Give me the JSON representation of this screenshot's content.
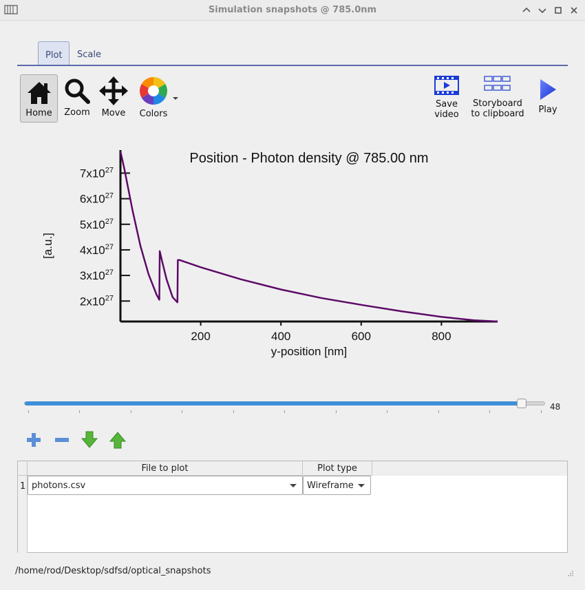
{
  "window": {
    "title": "Simulation snapshots @ 785.0nm"
  },
  "tabs": [
    {
      "label": "Plot",
      "active": true
    },
    {
      "label": "Scale",
      "active": false
    }
  ],
  "toolbar": {
    "home_label": "Home",
    "zoom_label": "Zoom",
    "move_label": "Move",
    "colors_label": "Colors",
    "save_video_label": [
      "Save",
      "video"
    ],
    "storyboard_label": [
      "Storyboard",
      "to clipboard"
    ],
    "play_label": "Play"
  },
  "chart_data": {
    "type": "line",
    "title": "Position - Photon density @ 785.00 nm",
    "xlabel": "y-position [nm]",
    "ylabel": "[a.u.]",
    "xlim": [
      0,
      940
    ],
    "ylim": [
      1.2e+27,
      7.9e+27
    ],
    "xticks": [
      200,
      400,
      600,
      800
    ],
    "yticks": [
      2e+27,
      3e+27,
      4e+27,
      5e+27,
      6e+27,
      7e+27
    ],
    "ytick_mantissas": [
      "2",
      "3",
      "4",
      "5",
      "6",
      "7"
    ],
    "ytick_base": "x10",
    "ytick_exponent": "27",
    "grid": false,
    "series": [
      {
        "color": "#5c0a66",
        "x": [
          0,
          10,
          30,
          50,
          70,
          90,
          97,
          98,
          104,
          115,
          130,
          142,
          143,
          148,
          200,
          300,
          400,
          500,
          600,
          700,
          800,
          880,
          940
        ],
        "y": [
          7.85e+27,
          7.15e+27,
          5.55e+27,
          4.15e+27,
          3.05e+27,
          2.25e+27,
          2.05e+27,
          3.95e+27,
          3.55e+27,
          2.85e+27,
          2.15e+27,
          1.95e+27,
          3.6e+27,
          3.6e+27,
          3.32e+27,
          2.85e+27,
          2.45e+27,
          2.12e+27,
          1.85e+27,
          1.6e+27,
          1.38e+27,
          1.25e+27,
          1.2e+27
        ]
      }
    ]
  },
  "slider": {
    "value": 48,
    "fraction": 0.955
  },
  "table": {
    "headers": [
      "File to plot",
      "Plot type"
    ],
    "rows": [
      {
        "index": "1",
        "file": "photons.csv",
        "plot_type": "Wireframe"
      }
    ]
  },
  "status": {
    "path": "/home/rod/Desktop/sdfsd/optical_snapshots"
  },
  "colors": {
    "accent": "#3d8fd8",
    "series": "#5c0a66",
    "icon_blue": "#1a3cd8"
  }
}
